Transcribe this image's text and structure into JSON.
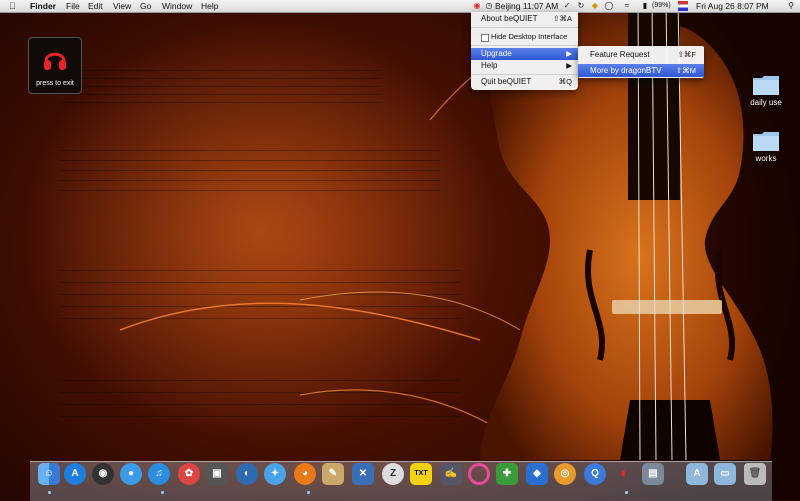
{
  "menubar": {
    "app_name": "Finder",
    "menus": [
      "File",
      "Edit",
      "View",
      "Go",
      "Window",
      "Help"
    ],
    "clock_city": "Beijing 11:07 AM",
    "battery": "(99%)",
    "datetime": "Fri Aug 26  8:07 PM"
  },
  "widget": {
    "label": "press to exit",
    "icon": "headphones-icon"
  },
  "dropdown": {
    "about": {
      "label": "About beQUIET",
      "shortcut": "⇧⌘A"
    },
    "hide": {
      "label": "Hide Desktop Interface",
      "checked": false
    },
    "upgrade": {
      "label": "Upgrade",
      "arrow": "▶"
    },
    "help": {
      "label": "Help",
      "arrow": "▶"
    },
    "quit": {
      "label": "Quit beQUIET",
      "shortcut": "⌘Q"
    }
  },
  "submenu": {
    "feature": {
      "label": "Feature Request",
      "shortcut": "⇧⌘F"
    },
    "more": {
      "label": "More by dragonBTV",
      "shortcut": "⇧⌘M"
    }
  },
  "desktop_folders": [
    {
      "label": "daily use"
    },
    {
      "label": "works"
    }
  ],
  "dock": {
    "items": [
      "finder",
      "app-store",
      "dashboard",
      "ichat",
      "itunes",
      "safari-alt",
      "photo-booth",
      "preview",
      "chrome",
      "safari",
      "firefox",
      "xcode",
      "address-book",
      "zip",
      "txt",
      "notes",
      "ring",
      "gift",
      "dropbox",
      "coins",
      "quicktime",
      "bequiet",
      "iphoto",
      "applications-folder",
      "documents-folder",
      "trash"
    ],
    "txt_label": "TXT",
    "z_label": "Z"
  },
  "colors": {
    "highlight": "#3b63de",
    "headphone_red": "#e8232a"
  }
}
